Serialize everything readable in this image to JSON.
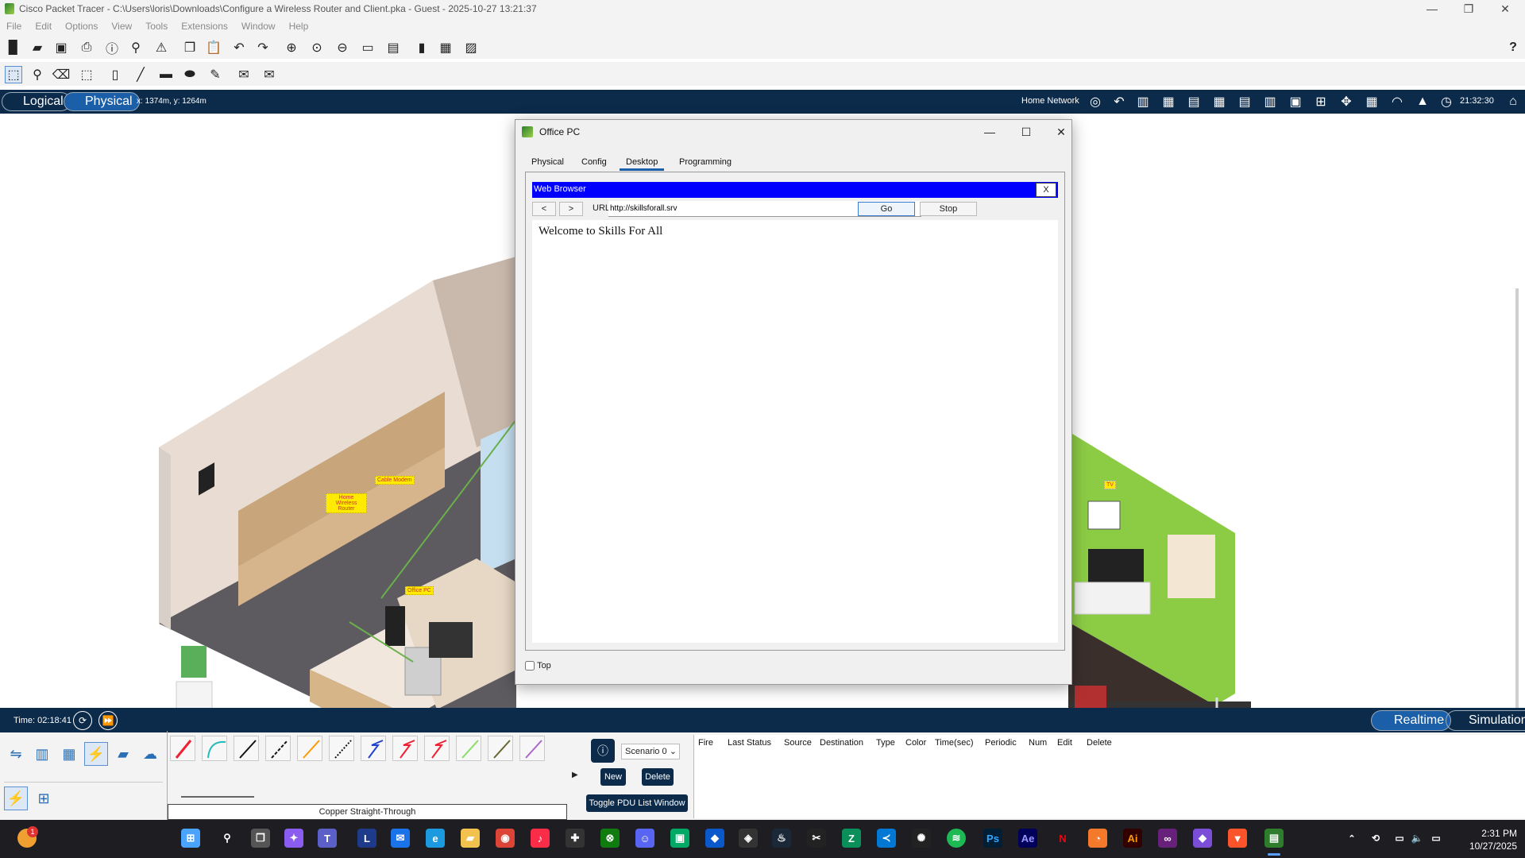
{
  "window": {
    "title": "Cisco Packet Tracer - C:\\Users\\loris\\Downloads\\Configure a Wireless Router and Client.pka - Guest - 2025-10-27 13:21:37",
    "minimize": "—",
    "maximize": "❐",
    "close": "✕"
  },
  "menu": [
    "File",
    "Edit",
    "Options",
    "View",
    "Tools",
    "Extensions",
    "Window",
    "Help"
  ],
  "help_icon": "?",
  "nav": {
    "logical_label": "Logical",
    "physical_label": "Physical",
    "coords": "x: 1374m, y: 1264m",
    "location": "Home Network",
    "clock": "21:32:30"
  },
  "workspace_labels": {
    "cable_modem": "Cable Modem",
    "router": "Home Wireless Router",
    "office_pc": "Office PC",
    "tv": "TV"
  },
  "dialog": {
    "title": "Office PC",
    "tabs": [
      "Physical",
      "Config",
      "Desktop",
      "Programming"
    ],
    "active_tab": "Desktop",
    "browser": {
      "title": "Web Browser",
      "close": "X",
      "back": "<",
      "forward": ">",
      "url_label": "URL",
      "url": "http://skillsforall.srv",
      "go": "Go",
      "stop": "Stop",
      "page_text": "Welcome to Skills For All"
    },
    "top_checkbox": "Top"
  },
  "bottom": {
    "time": "Time: 02:18:41",
    "realtime": "Realtime",
    "simulation": "Simulation",
    "cable_name": "Copper Straight-Through",
    "scenario": "Scenario 0",
    "new": "New",
    "delete": "Delete",
    "toggle_pdu": "Toggle PDU List Window",
    "pdu_headers": [
      "Fire",
      "Last Status",
      "Source",
      "Destination",
      "Type",
      "Color",
      "Time(sec)",
      "Periodic",
      "Num",
      "Edit",
      "Delete"
    ]
  },
  "taskbar": {
    "time": "2:31 PM",
    "date": "10/27/2025",
    "notification_badge": "1"
  },
  "colors": {
    "navbar": "#0c2a4a",
    "accent": "#1a5fa8",
    "browser_title": "#0000ff"
  }
}
